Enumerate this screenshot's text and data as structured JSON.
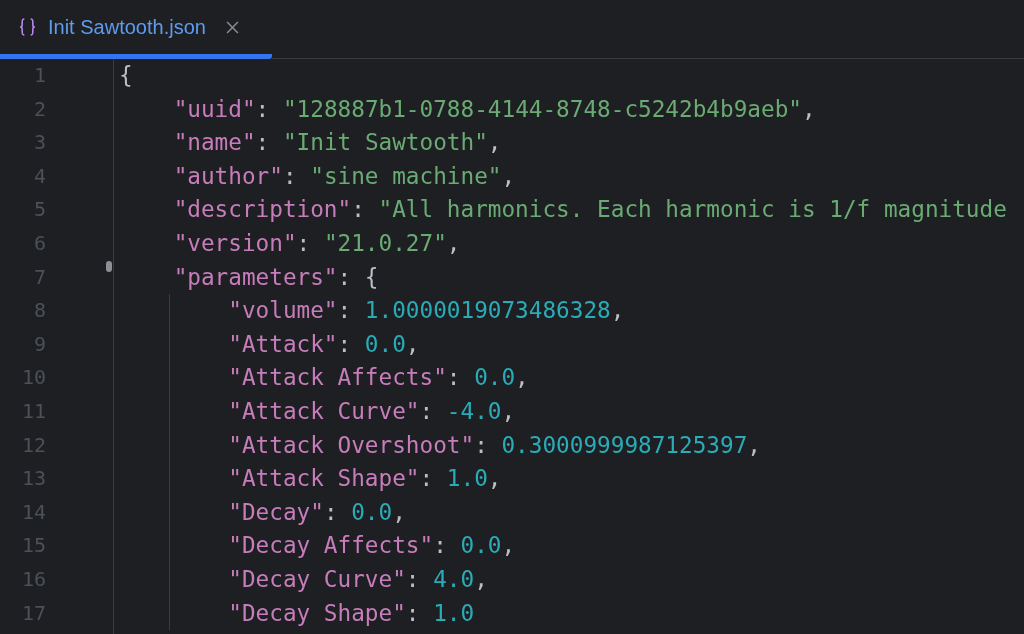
{
  "tab": {
    "title": "Init Sawtooth.json",
    "selected": true
  },
  "lines": [
    {
      "number": "1",
      "marker": false,
      "tokens": [
        {
          "kind": "punct",
          "text": "{"
        }
      ],
      "children": [
        {
          "number": "2",
          "marker": false,
          "tokens": [
            {
              "kind": "key",
              "text": "\"uuid\""
            },
            {
              "kind": "punct",
              "text": ": "
            },
            {
              "kind": "string",
              "text": "\"128887b1-0788-4144-8748-c5242b4b9aeb\""
            },
            {
              "kind": "punct",
              "text": ","
            }
          ]
        },
        {
          "number": "3",
          "marker": false,
          "tokens": [
            {
              "kind": "key",
              "text": "\"name\""
            },
            {
              "kind": "punct",
              "text": ": "
            },
            {
              "kind": "string",
              "text": "\"Init Sawtooth\""
            },
            {
              "kind": "punct",
              "text": ","
            }
          ]
        },
        {
          "number": "4",
          "marker": false,
          "tokens": [
            {
              "kind": "key",
              "text": "\"author\""
            },
            {
              "kind": "punct",
              "text": ": "
            },
            {
              "kind": "string",
              "text": "\"sine machine\""
            },
            {
              "kind": "punct",
              "text": ","
            }
          ]
        },
        {
          "number": "5",
          "marker": false,
          "tokens": [
            {
              "kind": "key",
              "text": "\"description\""
            },
            {
              "kind": "punct",
              "text": ": "
            },
            {
              "kind": "string",
              "text": "\"All harmonics. Each harmonic is 1/f magnitude"
            }
          ]
        },
        {
          "number": "6",
          "marker": false,
          "tokens": [
            {
              "kind": "key",
              "text": "\"version\""
            },
            {
              "kind": "punct",
              "text": ": "
            },
            {
              "kind": "string",
              "text": "\"21.0.27\""
            },
            {
              "kind": "punct",
              "text": ","
            }
          ]
        },
        {
          "number": "7",
          "marker": true,
          "tokens": [
            {
              "kind": "key",
              "text": "\"parameters\""
            },
            {
              "kind": "punct",
              "text": ": {"
            }
          ],
          "children": [
            {
              "number": "8",
              "marker": false,
              "tokens": [
                {
                  "kind": "key",
                  "text": "\"volume\""
                },
                {
                  "kind": "punct",
                  "text": ": "
                },
                {
                  "kind": "number",
                  "text": "1.0000019073486328"
                },
                {
                  "kind": "punct",
                  "text": ","
                }
              ]
            },
            {
              "number": "9",
              "marker": false,
              "tokens": [
                {
                  "kind": "key",
                  "text": "\"Attack\""
                },
                {
                  "kind": "punct",
                  "text": ": "
                },
                {
                  "kind": "number",
                  "text": "0.0"
                },
                {
                  "kind": "punct",
                  "text": ","
                }
              ]
            },
            {
              "number": "10",
              "marker": false,
              "tokens": [
                {
                  "kind": "key",
                  "text": "\"Attack Affects\""
                },
                {
                  "kind": "punct",
                  "text": ": "
                },
                {
                  "kind": "number",
                  "text": "0.0"
                },
                {
                  "kind": "punct",
                  "text": ","
                }
              ]
            },
            {
              "number": "11",
              "marker": false,
              "tokens": [
                {
                  "kind": "key",
                  "text": "\"Attack Curve\""
                },
                {
                  "kind": "punct",
                  "text": ": "
                },
                {
                  "kind": "number",
                  "text": "-4.0"
                },
                {
                  "kind": "punct",
                  "text": ","
                }
              ]
            },
            {
              "number": "12",
              "marker": false,
              "tokens": [
                {
                  "kind": "key",
                  "text": "\"Attack Overshoot\""
                },
                {
                  "kind": "punct",
                  "text": ": "
                },
                {
                  "kind": "number",
                  "text": "0.3000999987125397"
                },
                {
                  "kind": "punct",
                  "text": ","
                }
              ]
            },
            {
              "number": "13",
              "marker": false,
              "tokens": [
                {
                  "kind": "key",
                  "text": "\"Attack Shape\""
                },
                {
                  "kind": "punct",
                  "text": ": "
                },
                {
                  "kind": "number",
                  "text": "1.0"
                },
                {
                  "kind": "punct",
                  "text": ","
                }
              ]
            },
            {
              "number": "14",
              "marker": false,
              "tokens": [
                {
                  "kind": "key",
                  "text": "\"Decay\""
                },
                {
                  "kind": "punct",
                  "text": ": "
                },
                {
                  "kind": "number",
                  "text": "0.0"
                },
                {
                  "kind": "punct",
                  "text": ","
                }
              ]
            },
            {
              "number": "15",
              "marker": false,
              "tokens": [
                {
                  "kind": "key",
                  "text": "\"Decay Affects\""
                },
                {
                  "kind": "punct",
                  "text": ": "
                },
                {
                  "kind": "number",
                  "text": "0.0"
                },
                {
                  "kind": "punct",
                  "text": ","
                }
              ]
            },
            {
              "number": "16",
              "marker": false,
              "tokens": [
                {
                  "kind": "key",
                  "text": "\"Decay Curve\""
                },
                {
                  "kind": "punct",
                  "text": ": "
                },
                {
                  "kind": "number",
                  "text": "4.0"
                },
                {
                  "kind": "punct",
                  "text": ","
                }
              ]
            },
            {
              "number": "17",
              "marker": false,
              "tokens": [
                {
                  "kind": "key",
                  "text": "\"Decay Shape\""
                },
                {
                  "kind": "punct",
                  "text": ": "
                },
                {
                  "kind": "number",
                  "text": "1.0"
                }
              ]
            }
          ]
        }
      ]
    }
  ]
}
